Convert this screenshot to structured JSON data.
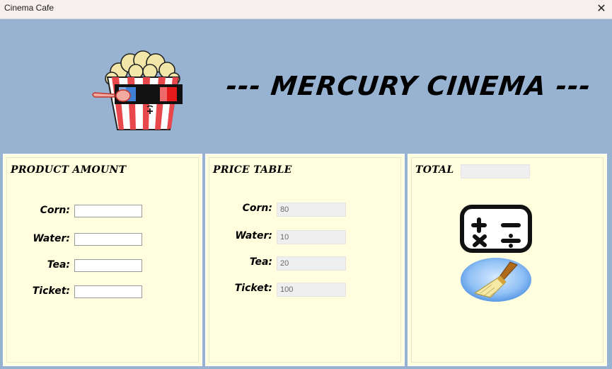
{
  "window": {
    "title": "Cinema Cafe",
    "close_glyph": "✕"
  },
  "header": {
    "brand": "--- MERCURY CINEMA ---",
    "logo_icon": "popcorn-3d-glasses-icon"
  },
  "product_amount": {
    "title": "PRODUCT AMOUNT",
    "fields": [
      {
        "label": "Corn:",
        "value": ""
      },
      {
        "label": "Water:",
        "value": ""
      },
      {
        "label": "Tea:",
        "value": ""
      },
      {
        "label": "Ticket:",
        "value": ""
      }
    ]
  },
  "price_table": {
    "title": "PRICE TABLE",
    "fields": [
      {
        "label": "Corn:",
        "value": "80"
      },
      {
        "label": "Water:",
        "value": "10"
      },
      {
        "label": "Tea:",
        "value": "20"
      },
      {
        "label": "Ticket:",
        "value": "100"
      }
    ]
  },
  "total": {
    "title": "TOTAL",
    "value": "",
    "calculate_icon": "calculator-icon",
    "clear_icon": "broom-icon"
  },
  "colors": {
    "background": "#98b3d2",
    "panel": "#ffffe0",
    "accent_blue": "#3f7fd6",
    "accent_red": "#e51b1b"
  }
}
